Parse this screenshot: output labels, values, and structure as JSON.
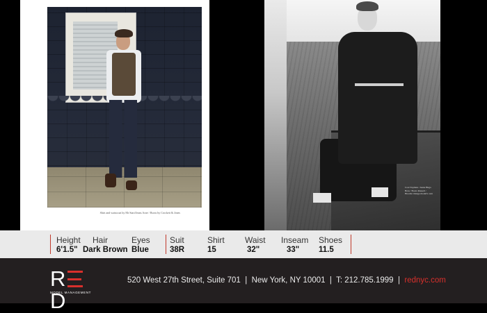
{
  "measurements": [
    {
      "label": "Height",
      "value": "6'1.5\""
    },
    {
      "label": "Hair",
      "value": "Dark Brown"
    },
    {
      "label": "Eyes",
      "value": "Blue"
    },
    {
      "label": "Suit",
      "value": "38R"
    },
    {
      "label": "Shirt",
      "value": "15"
    },
    {
      "label": "Waist",
      "value": "32\""
    },
    {
      "label": "Inseam",
      "value": "33\""
    },
    {
      "label": "Shoes",
      "value": "11.5"
    }
  ],
  "photos": {
    "left_caption": "Shirt and waistcoat by Mr Start/Jeans Acne / Boots by Crockett & Jones",
    "right_caption": "Coat Topman / Jeans Hugo Boss / Boots Russell / Hoodie vintage model's own"
  },
  "brand": {
    "logo_text": "RED",
    "logo_subtext": "MODEL MANAGEMENT",
    "accent_color": "#d9302c"
  },
  "contact": {
    "address": "520 West 27th Street, Suite 701",
    "city": "New York, NY 10001",
    "phone": "T: 212.785.1999",
    "website": "rednyc.com",
    "separator": "|"
  }
}
